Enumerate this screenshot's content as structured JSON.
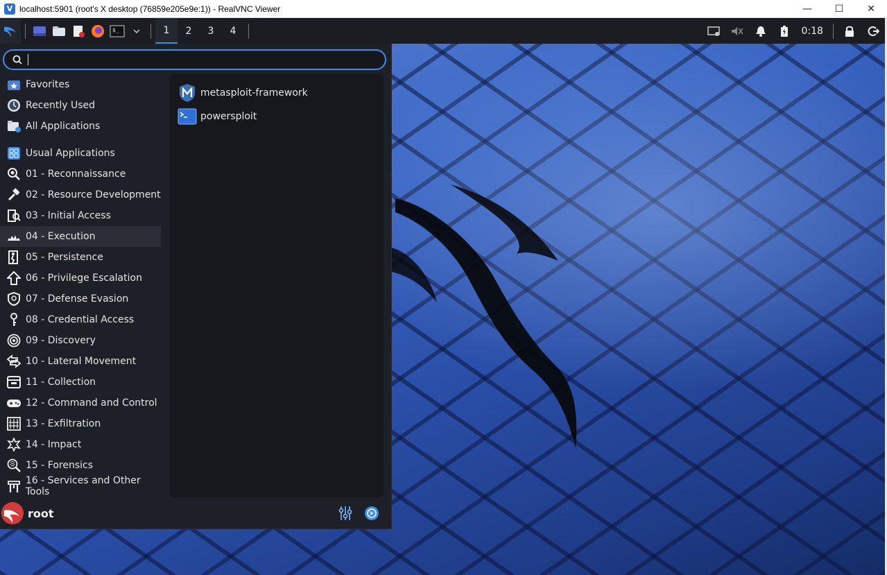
{
  "window": {
    "title": "localhost:5901 (root's X desktop (76859e205e9e:1)) - RealVNC Viewer",
    "app_icon": "vnc-icon",
    "controls": {
      "minimize": "—",
      "maximize": "☐",
      "close": "✕"
    }
  },
  "panel": {
    "workspaces": [
      "1",
      "2",
      "3",
      "4"
    ],
    "active_workspace": "1",
    "clock": "0:18",
    "launchers": [
      "desktop-icon",
      "file-manager-icon",
      "text-editor-icon",
      "firefox-icon",
      "terminal-icon"
    ]
  },
  "menu": {
    "search": {
      "value": "",
      "placeholder": ""
    },
    "categories_top": [
      {
        "label": "Favorites",
        "icon": "favorites-icon"
      },
      {
        "label": "Recently Used",
        "icon": "recently-used-icon"
      },
      {
        "label": "All Applications",
        "icon": "all-applications-icon"
      }
    ],
    "categories": [
      {
        "label": "Usual Applications",
        "icon": "usual-applications-icon"
      },
      {
        "label": "01 - Reconnaissance",
        "icon": "reconnaissance-icon"
      },
      {
        "label": "02 - Resource Development",
        "icon": "resource-development-icon"
      },
      {
        "label": "03 - Initial Access",
        "icon": "initial-access-icon"
      },
      {
        "label": "04 - Execution",
        "icon": "execution-icon"
      },
      {
        "label": "05 - Persistence",
        "icon": "persistence-icon"
      },
      {
        "label": "06 - Privilege Escalation",
        "icon": "privilege-escalation-icon"
      },
      {
        "label": "07 - Defense Evasion",
        "icon": "defense-evasion-icon"
      },
      {
        "label": "08 - Credential Access",
        "icon": "credential-access-icon"
      },
      {
        "label": "09 - Discovery",
        "icon": "discovery-icon"
      },
      {
        "label": "10 - Lateral Movement",
        "icon": "lateral-movement-icon"
      },
      {
        "label": "11 - Collection",
        "icon": "collection-icon"
      },
      {
        "label": "12 - Command and Control",
        "icon": "command-control-icon"
      },
      {
        "label": "13 - Exfiltration",
        "icon": "exfiltration-icon"
      },
      {
        "label": "14 - Impact",
        "icon": "impact-icon"
      },
      {
        "label": "15 - Forensics",
        "icon": "forensics-icon"
      },
      {
        "label": "16 - Services and Other Tools",
        "icon": "services-tools-icon"
      }
    ],
    "selected_category": "04 - Execution",
    "apps": [
      {
        "label": "metasploit-framework",
        "icon": "metasploit-icon"
      },
      {
        "label": "powersploit",
        "icon": "terminal-icon"
      }
    ],
    "user": "root"
  },
  "colors": {
    "accent": "#3b8fe8",
    "panel": "#1b1d23",
    "menu_bg": "#1e2028"
  }
}
